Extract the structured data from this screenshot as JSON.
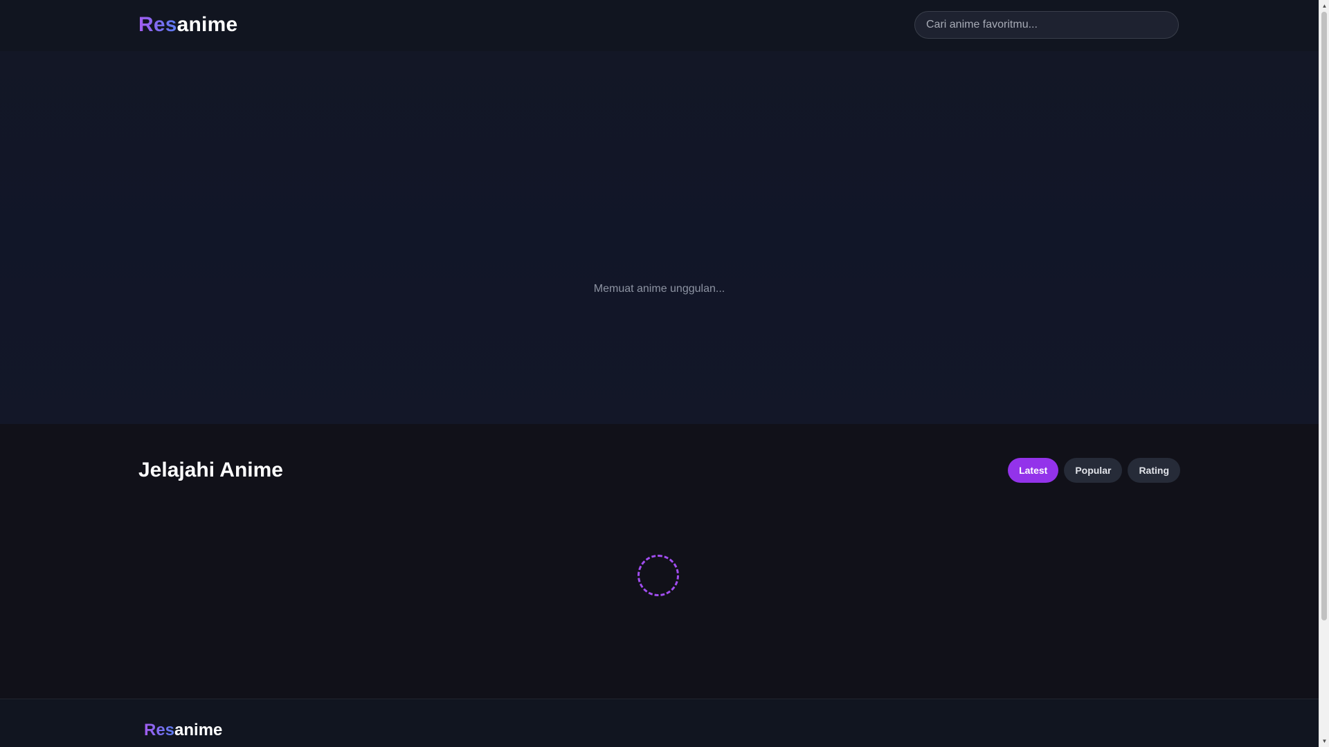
{
  "header": {
    "logo_accent": "Res",
    "logo_rest": "anime",
    "search_placeholder": "Cari anime favoritmu..."
  },
  "hero": {
    "loading_text": "Memuat anime unggulan..."
  },
  "browse": {
    "title": "Jelajahi Anime",
    "tabs": [
      {
        "label": "Latest",
        "active": true
      },
      {
        "label": "Popular",
        "active": false
      },
      {
        "label": "Rating",
        "active": false
      }
    ]
  },
  "footer": {
    "logo_accent": "Res",
    "logo_rest": "anime"
  },
  "icons": {
    "spinner": "loading-spinner-icon",
    "scroll_up": "chevron-up-icon",
    "scroll_down": "chevron-down-icon"
  },
  "colors": {
    "accent": "#9333ea",
    "logo_gradient_start": "#a35cf0",
    "logo_gradient_end": "#5b7cf0",
    "background": "#111119"
  }
}
